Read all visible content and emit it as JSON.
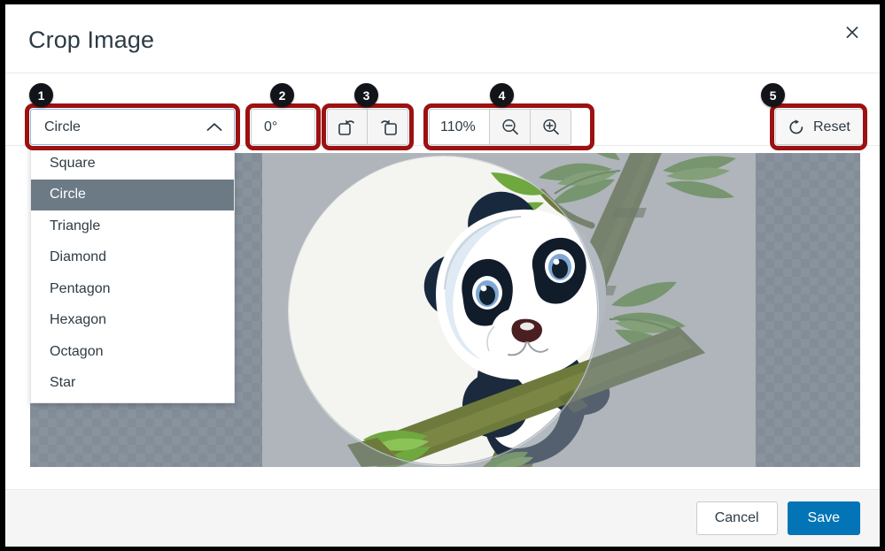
{
  "dialog": {
    "title": "Crop Image",
    "close_icon": "close-icon"
  },
  "toolbar": {
    "shape_select": {
      "value": "Circle",
      "chevron_icon": "chevron-up-icon",
      "options": [
        "Square",
        "Circle",
        "Triangle",
        "Diamond",
        "Pentagon",
        "Hexagon",
        "Octagon",
        "Star"
      ],
      "selected_index": 1
    },
    "rotation": {
      "value": "0°"
    },
    "rotate_left_icon": "rotate-left-icon",
    "rotate_right_icon": "rotate-right-icon",
    "zoom": {
      "level": "110%",
      "zoom_out_icon": "zoom-out-icon",
      "zoom_in_icon": "zoom-in-icon"
    },
    "reset": {
      "label": "Reset",
      "icon": "reset-icon"
    }
  },
  "preview": {
    "crop_shape": "circle",
    "image_subject": "cartoon panda climbing bamboo"
  },
  "footer": {
    "cancel_label": "Cancel",
    "save_label": "Save"
  },
  "annotations": {
    "badges": [
      {
        "number": "1",
        "target": "shape-select"
      },
      {
        "number": "2",
        "target": "rotation-field"
      },
      {
        "number": "3",
        "target": "rotate-group"
      },
      {
        "number": "4",
        "target": "zoom-group"
      },
      {
        "number": "5",
        "target": "reset-button"
      }
    ],
    "highlight_color": "#9c1111",
    "badge_color": "#111418"
  },
  "colors": {
    "accent_primary": "#0374b5",
    "text": "#2d3b45",
    "border": "#c7cdd1",
    "footer_bg": "#f5f5f5",
    "option_selected_bg": "#6c7a85"
  }
}
